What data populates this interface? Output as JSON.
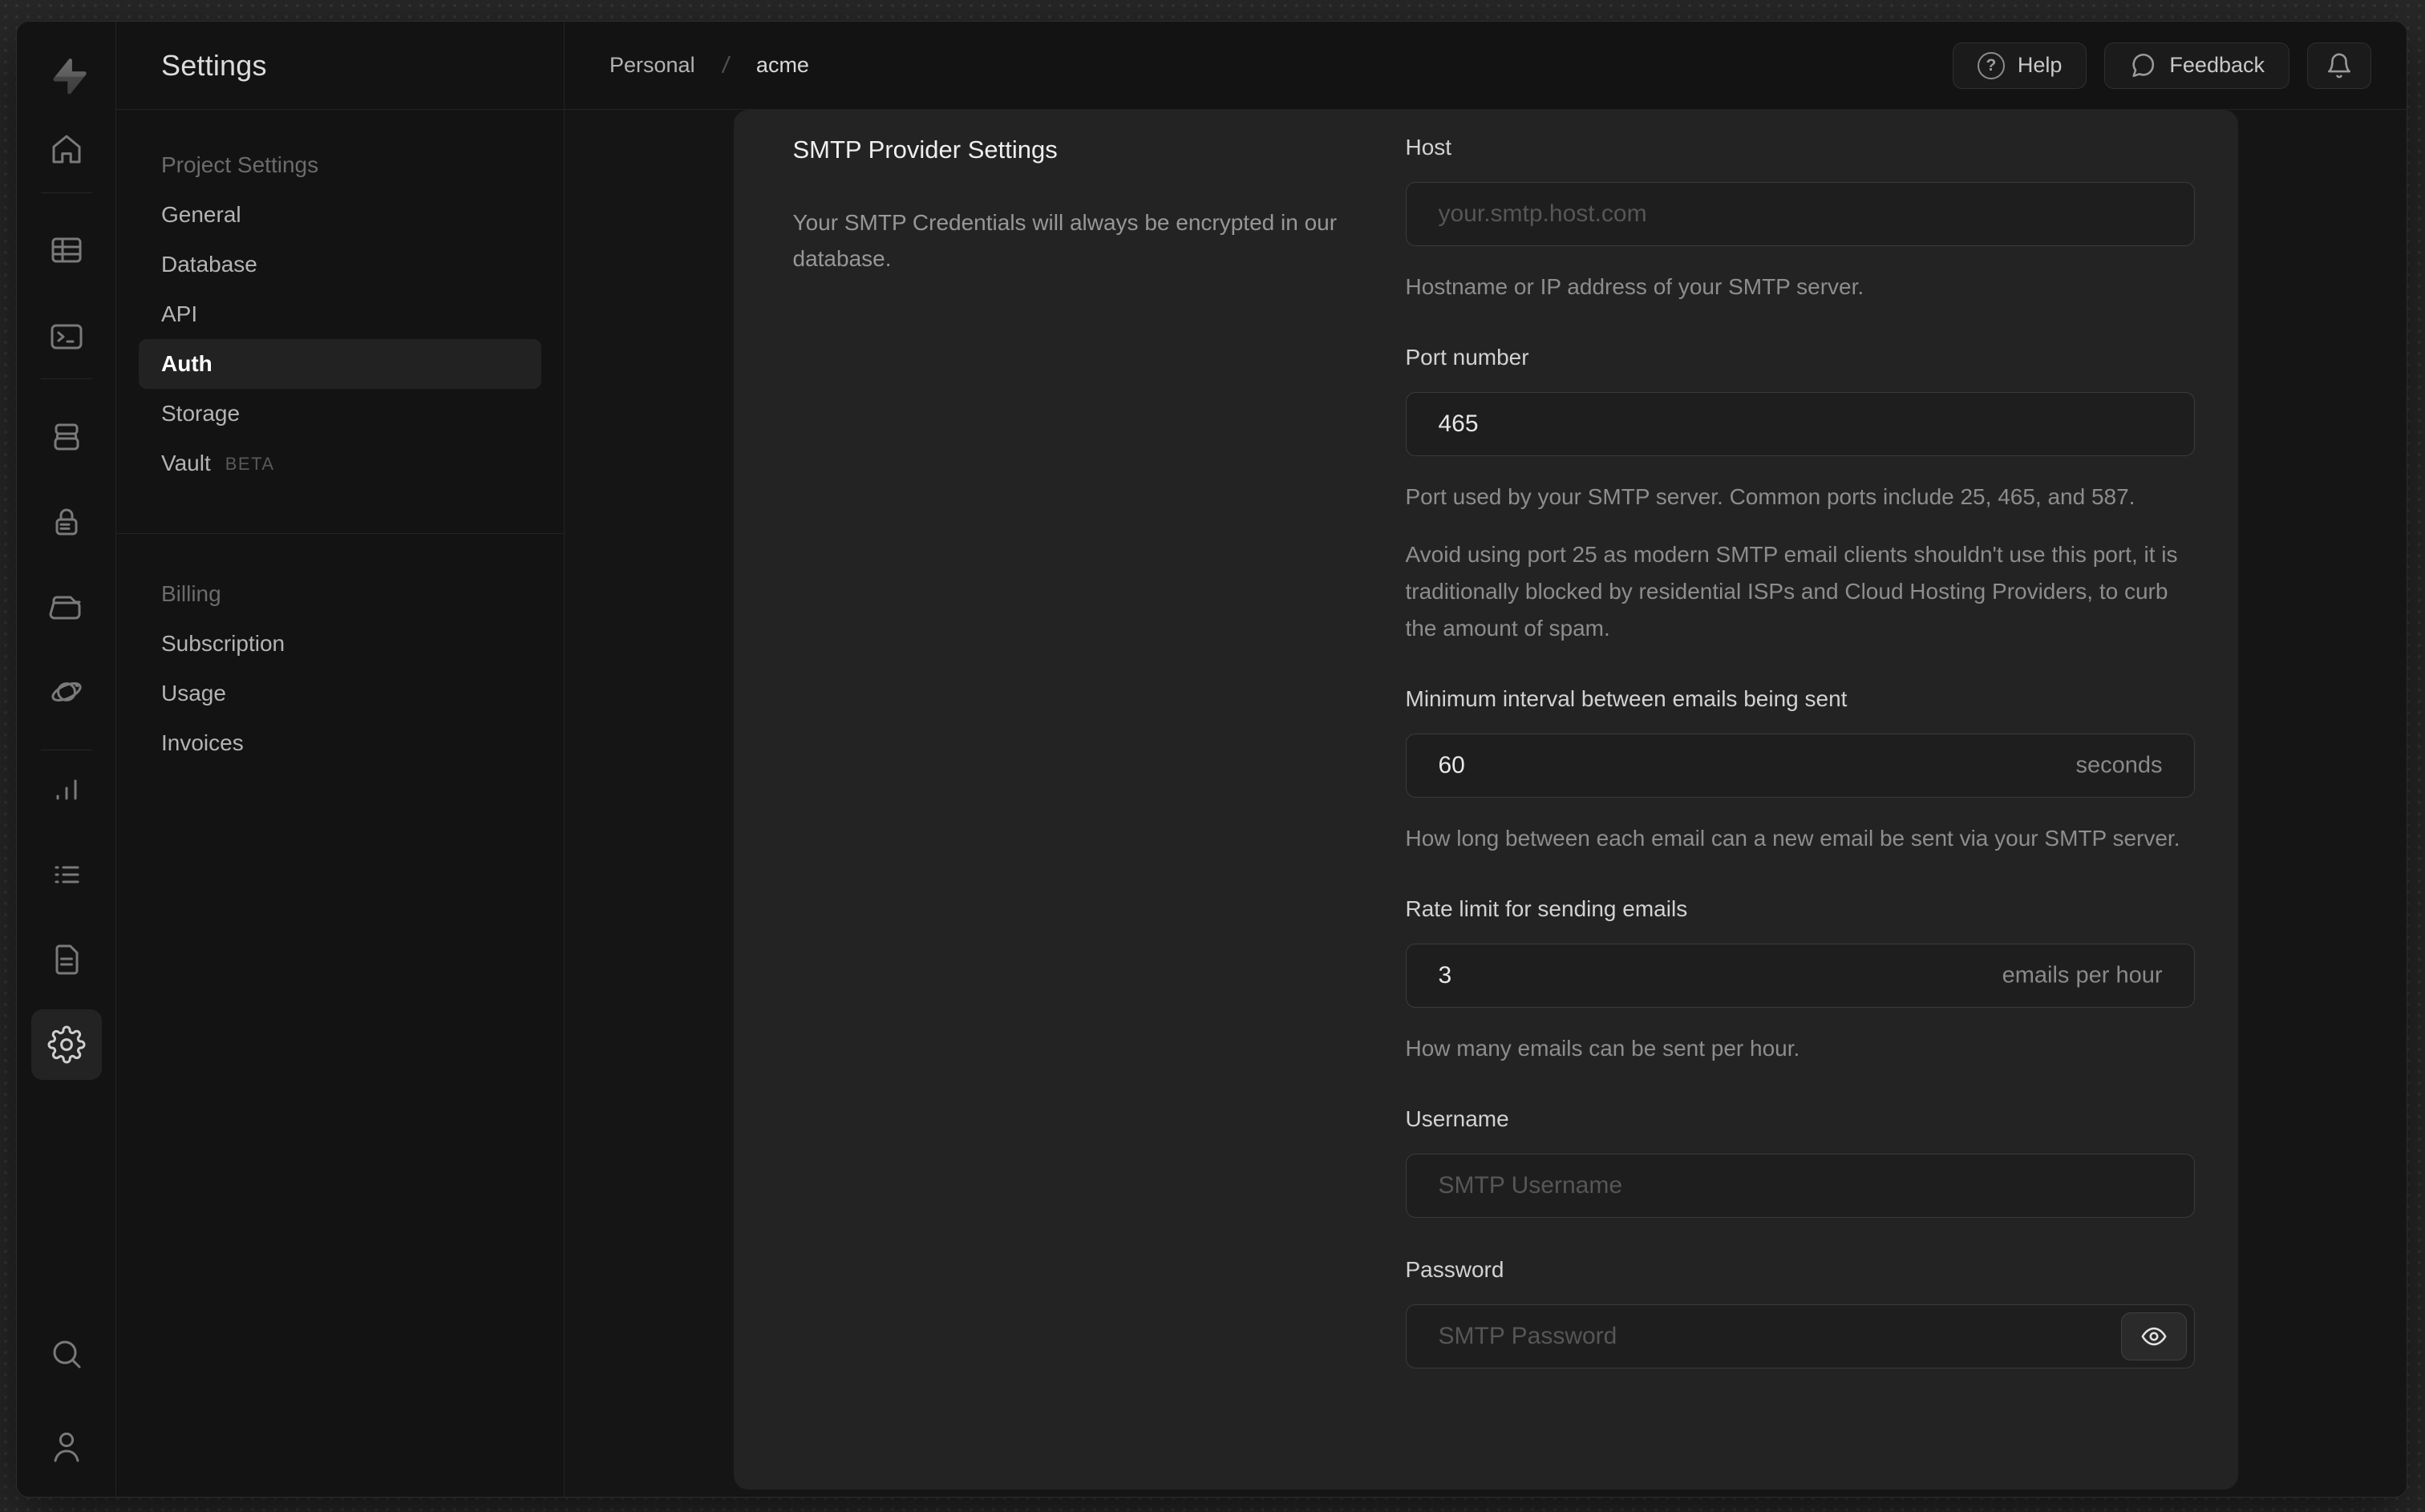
{
  "header": {
    "breadcrumb": {
      "org": "Personal",
      "separator": "/",
      "project": "acme"
    },
    "actions": {
      "help": "Help",
      "feedback": "Feedback"
    }
  },
  "sidebar": {
    "title": "Settings",
    "sections": [
      {
        "title": "Project Settings",
        "items": [
          {
            "label": "General"
          },
          {
            "label": "Database"
          },
          {
            "label": "API"
          },
          {
            "label": "Auth",
            "active": true
          },
          {
            "label": "Storage"
          },
          {
            "label": "Vault",
            "badge": "BETA"
          }
        ]
      },
      {
        "title": "Billing",
        "items": [
          {
            "label": "Subscription"
          },
          {
            "label": "Usage"
          },
          {
            "label": "Invoices"
          }
        ]
      }
    ]
  },
  "rail_icons": [
    "home-icon",
    "table-editor-icon",
    "sql-editor-icon",
    "database-icon",
    "auth-lock-icon",
    "storage-icon",
    "realtime-icon",
    "reports-icon",
    "logs-icon",
    "api-docs-icon",
    "settings-gear-icon",
    "search-icon",
    "profile-icon"
  ],
  "content": {
    "section_title": "SMTP Provider Settings",
    "section_description": "Your SMTP Credentials will always be encrypted in our database.",
    "fields": {
      "host": {
        "label": "Host",
        "placeholder": "your.smtp.host.com",
        "helper": "Hostname or IP address of your SMTP server."
      },
      "port": {
        "label": "Port number",
        "value": "465",
        "helper": "Port used by your SMTP server. Common ports include 25, 465, and 587.",
        "note": "Avoid using port 25 as modern SMTP email clients shouldn't use this port, it is traditionally blocked by residential ISPs and Cloud Hosting Providers, to curb the amount of spam."
      },
      "interval": {
        "label": "Minimum interval between emails being sent",
        "value": "60",
        "suffix": "seconds",
        "helper": "How long between each email can a new email be sent via your SMTP server."
      },
      "rate_limit": {
        "label": "Rate limit for sending emails",
        "value": "3",
        "suffix": "emails per hour",
        "helper": "How many emails can be sent per hour."
      },
      "username": {
        "label": "Username",
        "placeholder": "SMTP Username"
      },
      "password": {
        "label": "Password",
        "placeholder": "SMTP Password"
      }
    }
  },
  "colors": {
    "backdrop": "#282828",
    "app_background": "#131313",
    "panel_background": "#232323",
    "input_background": "#1e1e1e",
    "input_border": "#3b3b3b",
    "text_primary": "#efefef",
    "text_muted": "#8d8d8d",
    "nav_active_bg": "#222222"
  }
}
